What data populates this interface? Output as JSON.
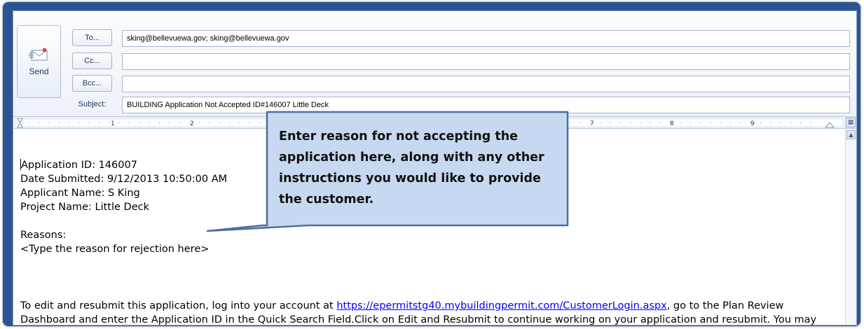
{
  "header": {
    "send_label": "Send",
    "to_button": "To...",
    "cc_button": "Cc...",
    "bcc_button": "Bcc...",
    "subject_label": "Subject:",
    "to_value": "sking@bellevuewa.gov; sking@bellevuewa.gov",
    "cc_value": "",
    "bcc_value": "",
    "subject_value": "BUILDING Application Not Accepted ID#146007 Little Deck"
  },
  "ruler": {
    "numbers": [
      "1",
      "2",
      "7",
      "8",
      "9"
    ]
  },
  "body": {
    "application_id": "Application ID: 146007",
    "date_submitted": "Date Submitted: 9/12/2013 10:50:00 AM",
    "applicant_name": "Applicant Name: S King",
    "project_name": "Project Name: Little Deck",
    "reasons_label": "Reasons:",
    "reason_placeholder": "<Type the reason for rejection here>",
    "para_prefix": "To edit and resubmit this application, log into your account at ",
    "link_text": "https://epermitstg40.mybuildingpermit.com/CustomerLogin.aspx",
    "para_suffix": ", go to the Plan Review Dashboard and enter the Application ID in the Quick Search Field.Click on Edit and Resubmit to continue working on your application and resubmit. You may also delete the application if you choose to."
  },
  "callout": {
    "text": "Enter reason for not accepting the application here, along with any other instructions you would like to provide the customer."
  },
  "colors": {
    "frame": "#2a5592",
    "callout_fill": "#c6d9f1",
    "callout_border": "#4f6e9c",
    "link": "#0000ff"
  },
  "icons": {
    "send": "envelope-send-icon",
    "ruler_toggle": "ruler-toggle-icon",
    "scroll_up": "scroll-up-arrow-icon"
  }
}
